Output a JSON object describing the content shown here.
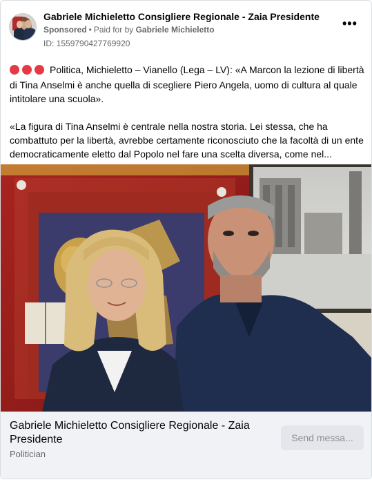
{
  "ad": {
    "page_name": "Gabriele Michieletto Consigliere Regionale - Zaia Presidente",
    "sponsored": "Sponsored",
    "separator": "•",
    "paid_for_prefix": "Paid for by",
    "paid_for_name": "Gabriele Michieletto",
    "id_text": "ID: 1559790427769920",
    "more_label": "•••"
  },
  "body": {
    "paragraph1": "Politica, Michieletto – Vianello (Lega – LV): «A Marcon la lezione di libertà di Tina Anselmi è anche quella di scegliere Piero Angela, uomo di cultura al quale intitolare una scuola».",
    "paragraph2": "«La figura di Tina Anselmi è centrale nella nostra storia. Lei stessa, che ha combattuto per la libertà, avrebbe certamente riconosciuto che la facoltà di un ente democraticamente eletto dal Popolo nel fare una scelta diversa, come nel..."
  },
  "footer": {
    "title": "Gabriele Michieletto Consigliere Regionale - Zaia Presidente",
    "subtitle": "Politician",
    "button_label": "Send messa..."
  },
  "colors": {
    "accent_dot": "#e63946",
    "footer_bg": "#f0f2f5",
    "muted_text": "#65676b"
  }
}
